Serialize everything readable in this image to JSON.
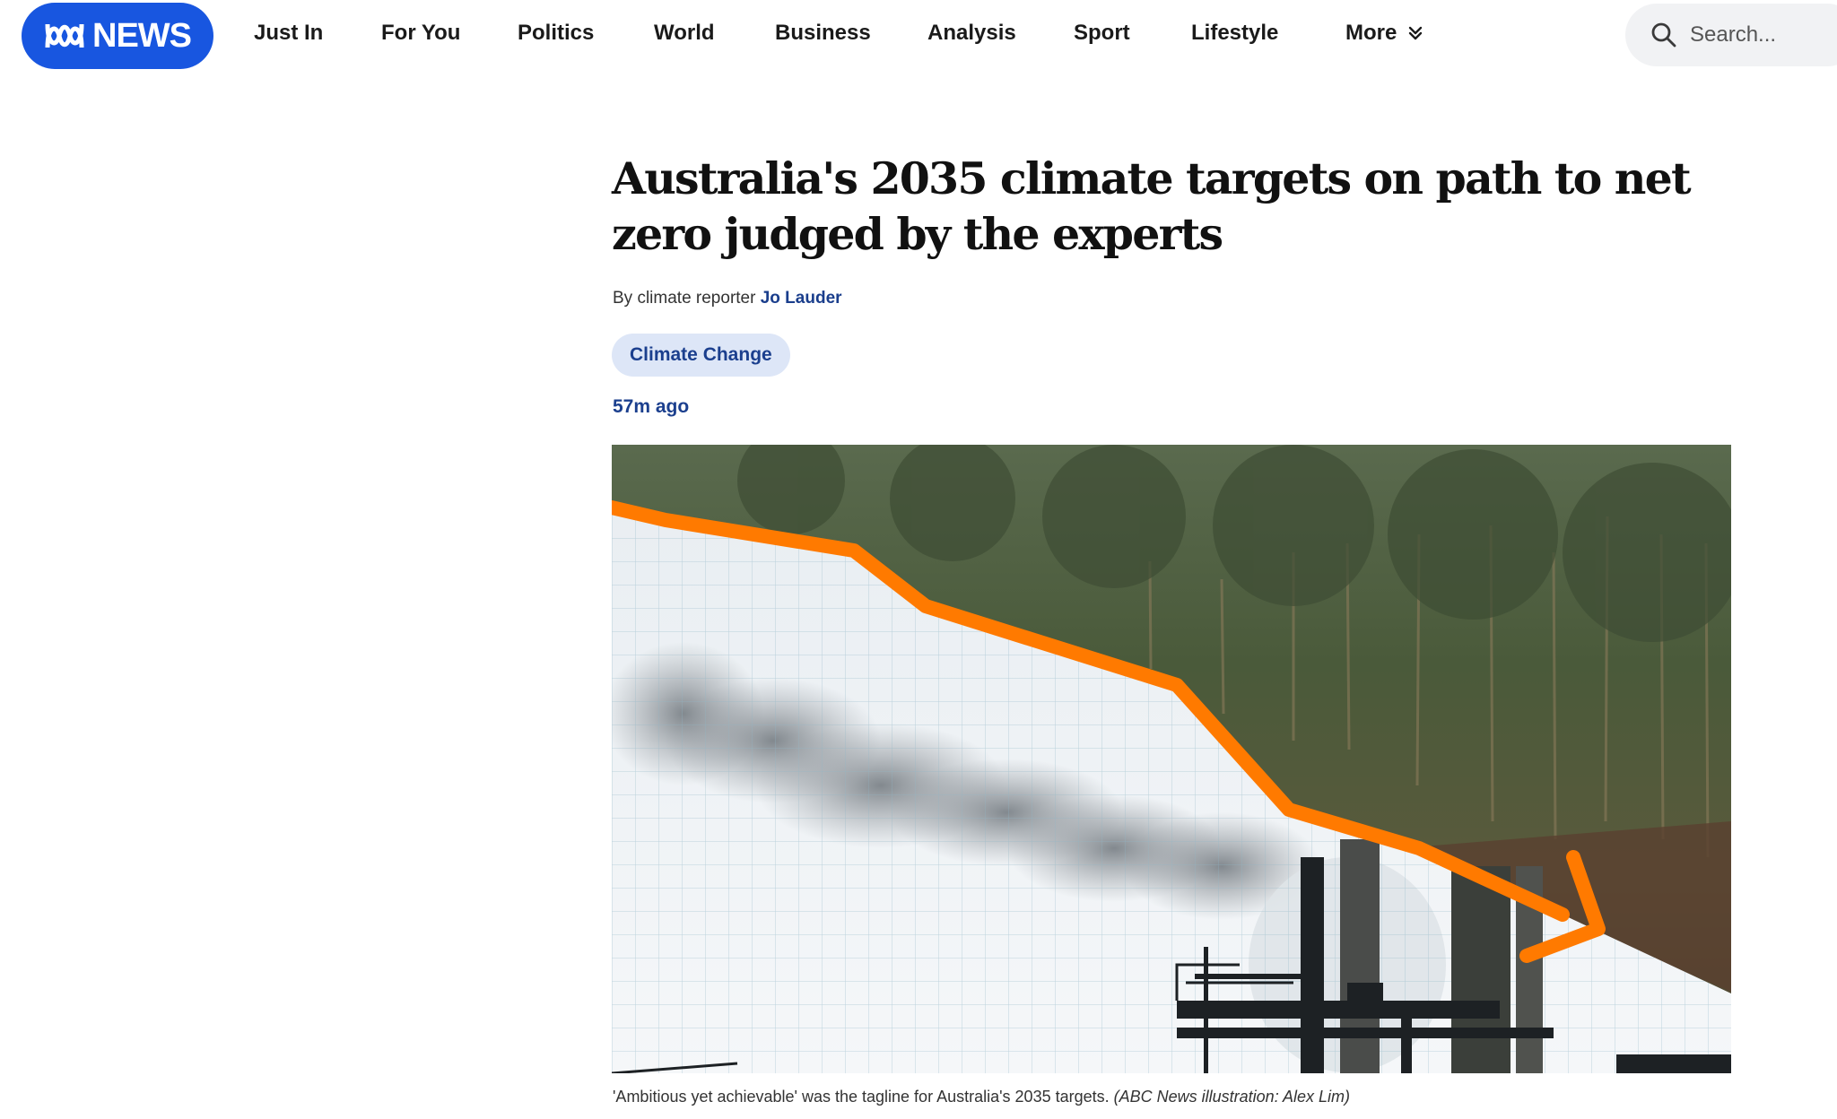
{
  "brand": {
    "logo_text": "NEWS",
    "accent_color": "#1856e0"
  },
  "nav": {
    "items": [
      {
        "label": "Just In"
      },
      {
        "label": "For You"
      },
      {
        "label": "Politics"
      },
      {
        "label": "World"
      },
      {
        "label": "Business"
      },
      {
        "label": "Analysis"
      },
      {
        "label": "Sport"
      },
      {
        "label": "Lifestyle"
      }
    ],
    "more_label": "More",
    "more_icon": "chevron-double-down-icon"
  },
  "search": {
    "placeholder": "Search...",
    "icon": "search-icon"
  },
  "article": {
    "headline": "Australia's 2035 climate targets on path to net zero judged by the experts",
    "byline_prefix": "By climate reporter",
    "author": "Jo Lauder",
    "tag": "Climate Change",
    "timestamp": "57m ago",
    "image": {
      "description_icon": "declining-emissions-illustration",
      "line_color": "#ff7a00"
    },
    "caption_text": "'Ambitious yet achievable' was the tagline for Australia's 2035 targets.",
    "caption_credit": "(ABC News illustration: Alex Lim)"
  }
}
